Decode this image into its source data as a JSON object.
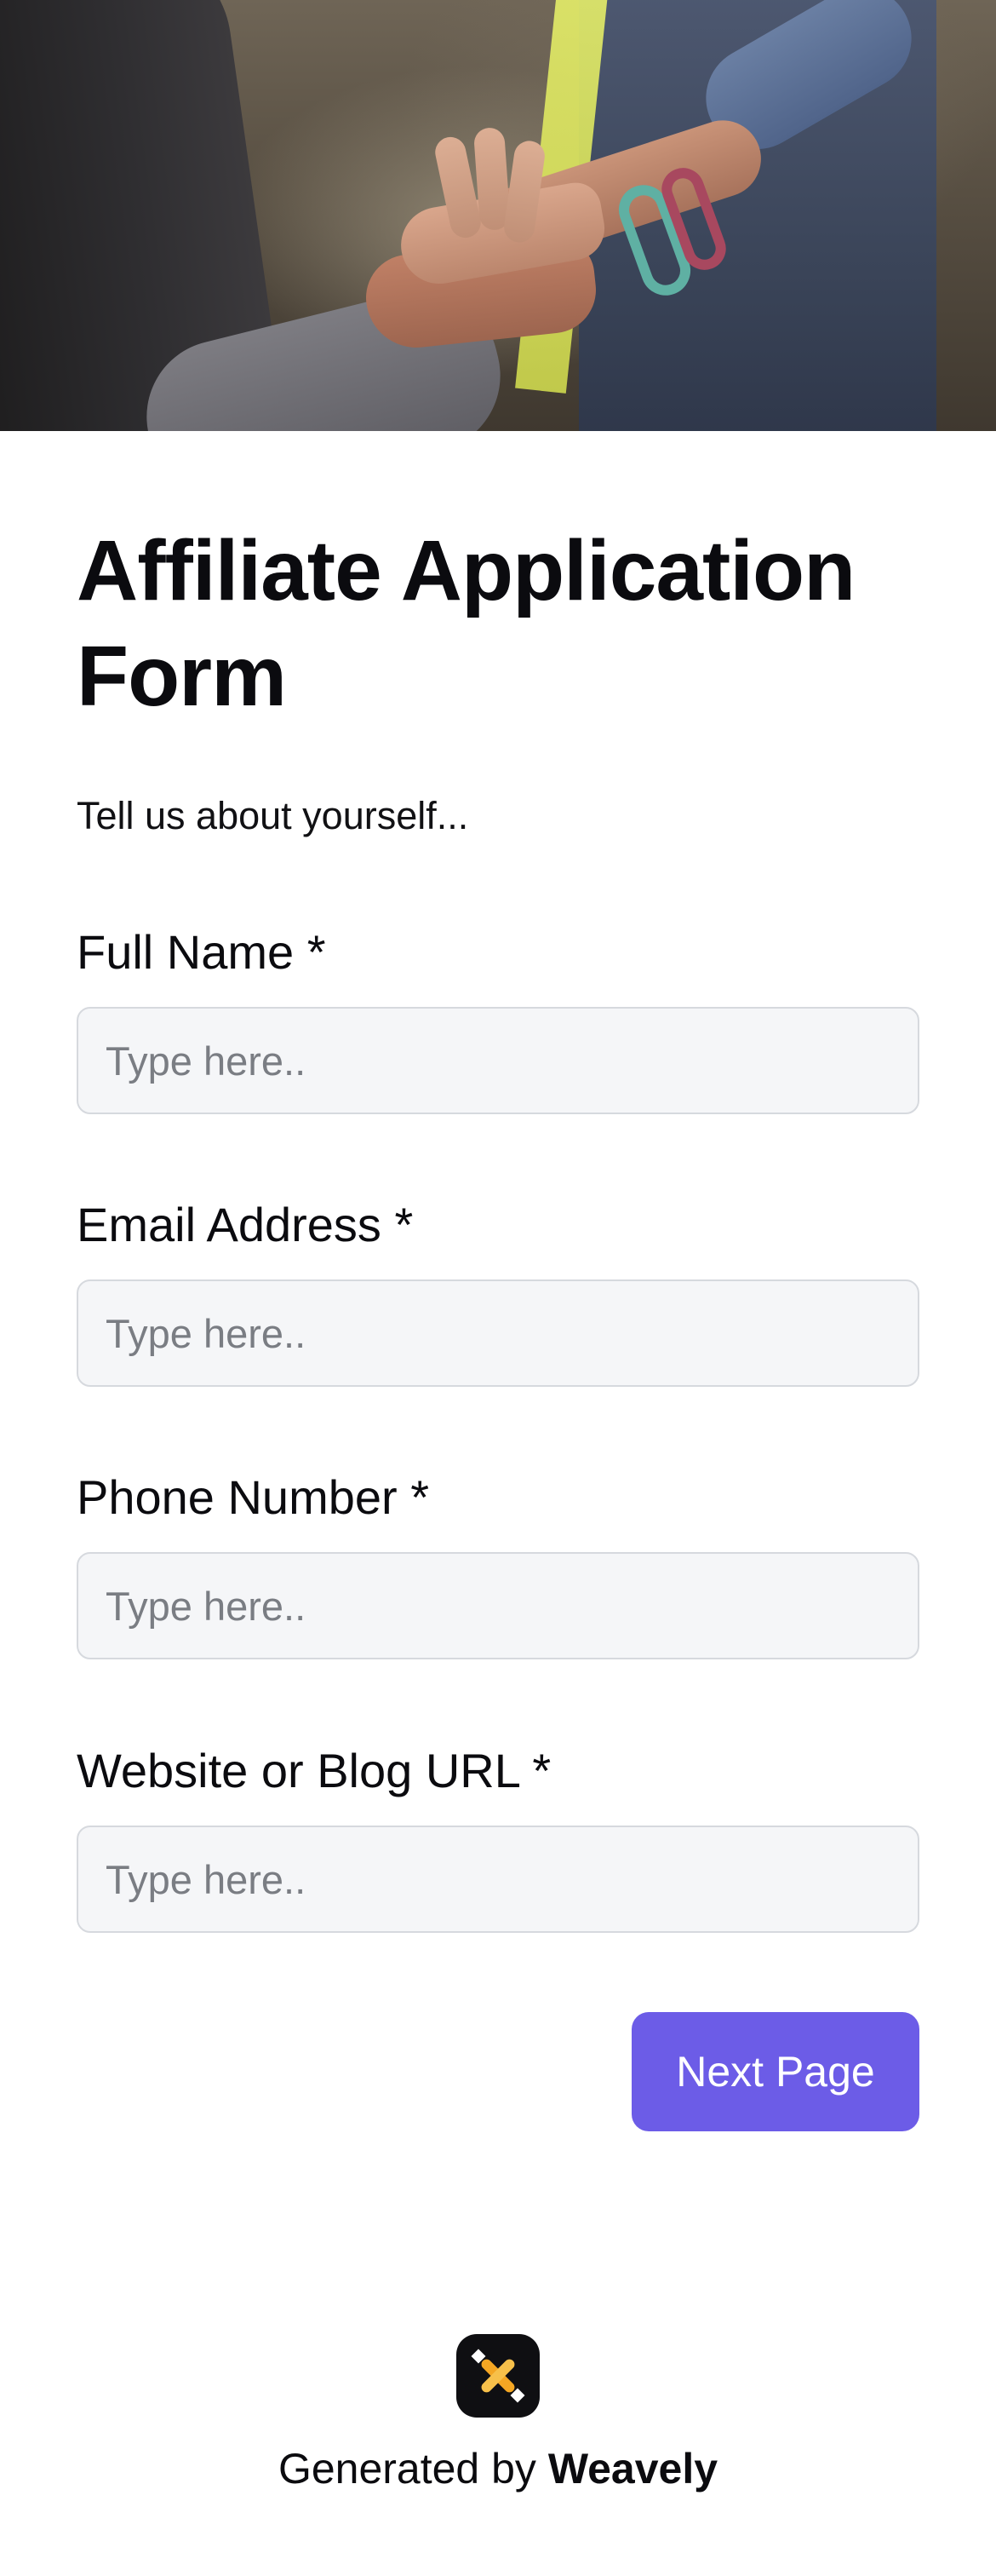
{
  "form": {
    "title": "Affiliate Application Form",
    "subtitle": "Tell us about yourself...",
    "fields": [
      {
        "label": "Full Name *",
        "placeholder": "Type here..",
        "value": ""
      },
      {
        "label": "Email Address *",
        "placeholder": "Type here..",
        "value": ""
      },
      {
        "label": "Phone Number *",
        "placeholder": "Type here..",
        "value": ""
      },
      {
        "label": "Website or Blog URL *",
        "placeholder": "Type here..",
        "value": ""
      }
    ],
    "next_button_label": "Next Page"
  },
  "header_image": {
    "icon": "hands-together-photo"
  },
  "footer": {
    "prefix": "Generated by ",
    "brand": "Weavely",
    "logo_icon": "weavely-logo-icon"
  },
  "colors": {
    "accent": "#6c5ce7",
    "input_bg": "#f5f6f8",
    "input_border": "#d6d9de",
    "logo_bg": "#0f0f12",
    "logo_accent": "#f4a623"
  }
}
